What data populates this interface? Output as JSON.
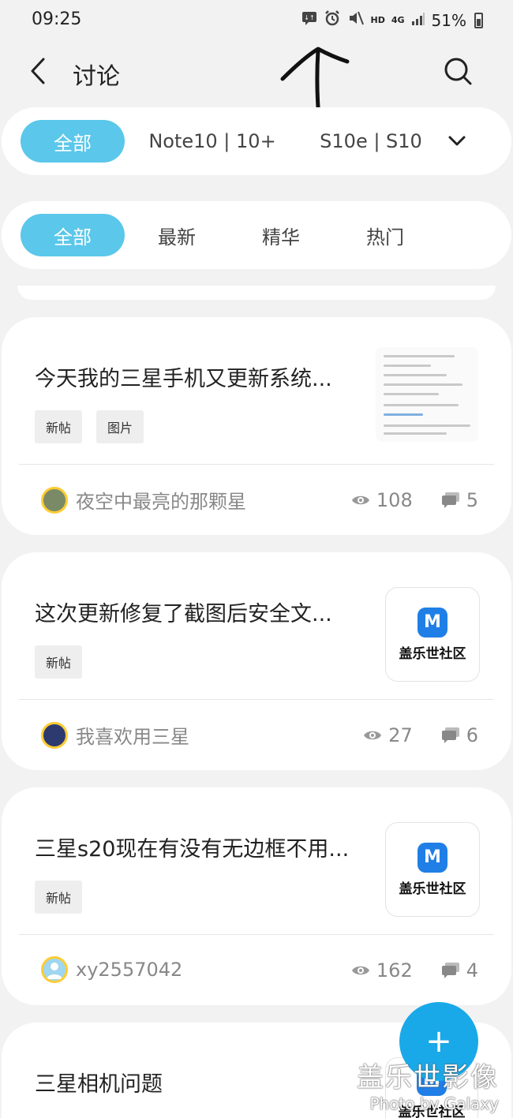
{
  "status_bar": {
    "time": "09:25",
    "network": "4G",
    "hd": "HD",
    "battery": "51%"
  },
  "app_bar": {
    "title": "讨论"
  },
  "model_filter": {
    "chips": [
      "全部",
      "Note10 | 10+",
      "S10e | S10"
    ]
  },
  "sort_filter": {
    "chips": [
      "全部",
      "最新",
      "精华",
      "热门"
    ]
  },
  "posts": [
    {
      "title": "今天我的三星手机又更新系统...",
      "tags": [
        "新帖",
        "图片"
      ],
      "author": "夜空中最亮的那颗星",
      "views": "108",
      "comments": "5"
    },
    {
      "title": "这次更新修复了截图后安全文...",
      "tags": [
        "新帖"
      ],
      "author": "我喜欢用三星",
      "views": "27",
      "comments": "6",
      "logo_text": "盖乐世社区"
    },
    {
      "title": "三星s20现在有没有无边框不用...",
      "tags": [
        "新帖"
      ],
      "author": "xy2557042",
      "views": "162",
      "comments": "4",
      "logo_text": "盖乐世社区"
    },
    {
      "title": "三星相机问题",
      "logo_text": "盖乐世社区"
    }
  ],
  "fab": {
    "label": "+"
  },
  "watermark": {
    "main": "盖乐世影像",
    "sub": "Photo by Galaxy"
  },
  "colors": {
    "accent": "#5bc7ea",
    "fab": "#1aa9e8",
    "brand_logo": "#1f7fe6"
  }
}
